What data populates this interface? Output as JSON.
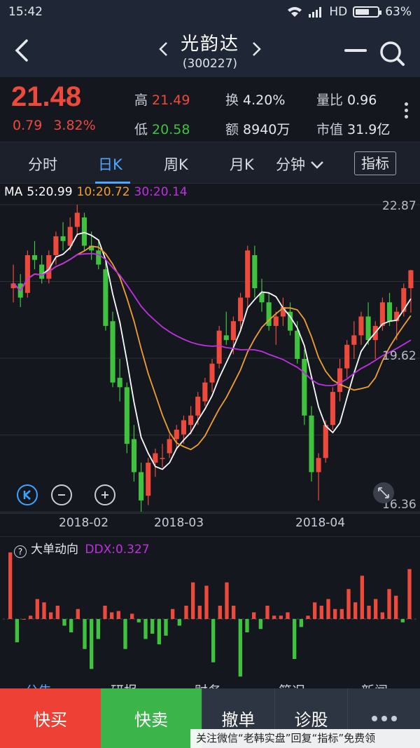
{
  "status": {
    "time": "15:42",
    "network": "HD",
    "battery": "63%",
    "battery_level": 0.63
  },
  "header": {
    "title": "光韵达",
    "code": "(300227)"
  },
  "quote": {
    "price": "21.48",
    "change": "0.79",
    "change_pct": "3.82%",
    "high_label": "高",
    "high": "21.49",
    "low_label": "低",
    "low": "20.58",
    "turnover_label": "换",
    "turnover": "4.20%",
    "amount_label": "额",
    "amount": "8940万",
    "volratio_label": "量比",
    "volratio": "0.96",
    "mktcap_label": "市值",
    "mktcap": "31.9亿"
  },
  "tabs": {
    "items": [
      "分时",
      "日K",
      "周K",
      "月K",
      "分钟"
    ],
    "active": "日K",
    "indicator": "指标"
  },
  "chart_data": {
    "type": "candlestick",
    "ma_label": "MA",
    "ma5": "5:20.99",
    "ma10": "10:20.72",
    "ma30": "30:20.14",
    "y_labels": [
      "22.87",
      "19.62",
      "16.36"
    ],
    "ylim": [
      16.36,
      22.87
    ],
    "x_labels": [
      "2018-02",
      "2018-03",
      "2018-04"
    ],
    "colors": {
      "up": "#ee4a3c",
      "down": "#3fc33f",
      "ma5": "#ffffff",
      "ma10": "#f0a030",
      "ma30": "#c030e0"
    },
    "candles": [
      [
        21.1,
        21.6,
        20.8,
        21.2
      ],
      [
        21.2,
        21.4,
        20.7,
        20.9
      ],
      [
        21.0,
        21.9,
        20.9,
        21.8
      ],
      [
        21.8,
        22.1,
        21.5,
        21.7
      ],
      [
        21.6,
        21.8,
        21.2,
        21.3
      ],
      [
        21.3,
        21.9,
        21.2,
        21.8
      ],
      [
        21.8,
        22.3,
        21.6,
        22.2
      ],
      [
        22.2,
        22.5,
        21.9,
        22.1
      ],
      [
        22.0,
        22.6,
        21.9,
        22.4
      ],
      [
        22.4,
        22.87,
        22.2,
        22.7
      ],
      [
        22.6,
        22.7,
        21.9,
        22.0
      ],
      [
        22.0,
        22.3,
        21.7,
        21.9
      ],
      [
        21.9,
        22.1,
        21.5,
        21.6
      ],
      [
        21.5,
        21.7,
        20.2,
        20.3
      ],
      [
        20.4,
        20.6,
        19.0,
        19.1
      ],
      [
        19.2,
        19.6,
        18.7,
        19.0
      ],
      [
        19.0,
        19.1,
        17.6,
        17.8
      ],
      [
        17.9,
        18.2,
        17.0,
        17.2
      ],
      [
        17.2,
        17.4,
        16.36,
        16.6
      ],
      [
        16.7,
        17.5,
        16.5,
        17.4
      ],
      [
        17.4,
        17.7,
        17.1,
        17.6
      ],
      [
        17.5,
        17.8,
        17.3,
        17.5
      ],
      [
        17.6,
        18.0,
        17.5,
        17.9
      ],
      [
        17.9,
        18.2,
        17.7,
        18.1
      ],
      [
        18.0,
        18.4,
        17.8,
        18.3
      ],
      [
        18.2,
        18.6,
        18.0,
        18.4
      ],
      [
        18.4,
        18.9,
        18.2,
        18.8
      ],
      [
        18.7,
        19.2,
        18.6,
        19.1
      ],
      [
        19.1,
        19.6,
        18.9,
        19.5
      ],
      [
        19.5,
        20.3,
        19.4,
        20.2
      ],
      [
        20.1,
        20.6,
        19.9,
        20.0
      ],
      [
        20.0,
        20.5,
        19.7,
        20.4
      ],
      [
        20.4,
        21.0,
        20.2,
        20.9
      ],
      [
        20.9,
        22.0,
        20.7,
        21.9
      ],
      [
        21.8,
        22.0,
        20.9,
        21.1
      ],
      [
        21.0,
        21.3,
        20.6,
        20.8
      ],
      [
        20.8,
        21.0,
        20.2,
        20.3
      ],
      [
        20.3,
        20.6,
        19.9,
        20.5
      ],
      [
        20.5,
        20.9,
        20.3,
        20.7
      ],
      [
        20.6,
        20.8,
        20.1,
        20.2
      ],
      [
        20.2,
        20.4,
        19.5,
        19.6
      ],
      [
        19.6,
        19.8,
        18.2,
        18.4
      ],
      [
        18.4,
        18.6,
        17.0,
        17.2
      ],
      [
        17.2,
        17.6,
        16.6,
        17.5
      ],
      [
        17.5,
        18.3,
        17.4,
        18.2
      ],
      [
        18.2,
        19.0,
        18.1,
        18.9
      ],
      [
        18.9,
        19.6,
        18.7,
        19.4
      ],
      [
        19.4,
        20.0,
        19.2,
        19.9
      ],
      [
        19.9,
        20.4,
        19.6,
        20.1
      ],
      [
        20.1,
        20.6,
        19.9,
        20.5
      ],
      [
        20.5,
        20.8,
        19.9,
        20.0
      ],
      [
        20.0,
        20.4,
        19.6,
        20.3
      ],
      [
        20.3,
        20.9,
        20.2,
        20.8
      ],
      [
        20.8,
        21.0,
        20.3,
        20.4
      ],
      [
        20.4,
        20.7,
        20.0,
        20.6
      ],
      [
        20.6,
        21.2,
        20.5,
        21.1
      ],
      [
        21.1,
        21.49,
        20.58,
        21.48
      ]
    ]
  },
  "ddx": {
    "title": "大单动向",
    "value_text": "DDX:0.327",
    "colors": {
      "pos": "#ee4a3c",
      "neg": "#3fc33f"
    },
    "bars": [
      1.0,
      -0.35,
      0.0,
      0.05,
      0.3,
      0.25,
      0.1,
      0.2,
      -0.1,
      -0.2,
      0.15,
      -0.45,
      -0.75,
      -0.3,
      0.2,
      0.1,
      0.12,
      -0.45,
      0.08,
      -0.05,
      -0.3,
      -0.22,
      -0.38,
      -0.25,
      0.15,
      -0.1,
      0.2,
      0.55,
      0.2,
      0.5,
      -0.65,
      0.2,
      0.55,
      0.2,
      -0.95,
      -0.2,
      0.1,
      -0.15,
      0.2,
      0.05,
      0.05,
      0.1,
      -0.6,
      -0.12,
      0.05,
      0.25,
      0.2,
      0.3,
      0.15,
      0.15,
      0.45,
      0.25,
      0.65,
      0.2,
      0.3,
      0.1,
      0.45,
      0.35,
      -0.05,
      0.75
    ]
  },
  "subtabs": [
    "公告",
    "研报",
    "财务",
    "简况",
    "新闻"
  ],
  "actions": {
    "buy": "快买",
    "sell": "快卖",
    "cancel": "撤单",
    "diagnose": "诊股"
  },
  "watermark": "关注微信“老韩实盘”回复“指标”免费领"
}
